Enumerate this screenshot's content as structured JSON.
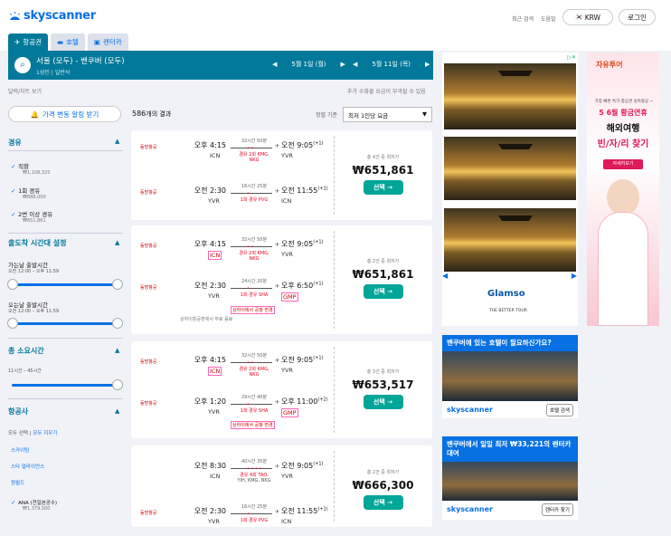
{
  "header": {
    "logo": "skyscanner",
    "links": [
      "최근 검색",
      "도움말"
    ],
    "currency": "KRW",
    "login": "로그인"
  },
  "tabs": [
    {
      "label": "항공권"
    },
    {
      "label": "호텔"
    },
    {
      "label": "렌터카"
    }
  ],
  "search": {
    "route": "서울 (모두) - 밴쿠버 (모두)",
    "sub": "1성인 | 일반석",
    "depart_date": "5월 1일 (월)",
    "return_date": "5월 11일 (목)"
  },
  "sublinks": {
    "left": "달력/차트 보기",
    "right": "추가 수화물 요금이 부과될 수 있음"
  },
  "alert_btn": "가격 변동 알림 받기",
  "results": {
    "count": "586",
    "suffix": "개의 결과",
    "sort_label": "정렬 기준",
    "sort_value": "최저 1인당 요금"
  },
  "filters": {
    "stops_title": "경유",
    "stops": [
      {
        "label": "직항",
        "price": "₩1,108,325"
      },
      {
        "label": "1회 경유",
        "price": "₩888,000"
      },
      {
        "label": "2번 이상 경유",
        "price": "₩651,861"
      }
    ],
    "time_title": "출도착 시간대 설정",
    "outbound_label": "가는날 출발시간",
    "outbound_range": "오전 12:00 – 오후 11:59",
    "return_label": "오는날 출발시간",
    "return_range": "오전 12:00 – 오후 11:59",
    "duration_title": "총 소요시간",
    "duration_range": "11시간 – 45시간",
    "airlines_title": "항공사",
    "airlines_links": [
      "모두 선택",
      "모두 지우기"
    ],
    "airline_groups": [
      "스카이팀",
      "스타 얼라이언스",
      "원월드"
    ],
    "airline_item": {
      "label": "ANA (전일본공수)",
      "price": "₩1,379,500"
    }
  },
  "cards": [
    {
      "legs": [
        {
          "airline": "동방항공",
          "dep": "오후 4:15",
          "dap": "ICN",
          "dur": "32시간 50분",
          "stops": "경유 2회 KMG,",
          "stops2": "NKG",
          "arr": "오전 9:05",
          "plus": "(+1)",
          "aap": "YVR"
        },
        {
          "airline": "동방항공",
          "dep": "오전 2:30",
          "dap": "YVR",
          "dur": "16시간 25분",
          "stops": "1회 경유 PVG",
          "stops2": "",
          "arr": "오전 11:55",
          "plus": "(+1)",
          "aap": "ICN"
        }
      ],
      "deals": "총 4건 중 최저가",
      "price": "₩651,861",
      "select": "선택 →"
    },
    {
      "legs": [
        {
          "airline": "동방항공",
          "dep": "오후 4:15",
          "dap": "ICN",
          "dur": "32시간 50분",
          "stops": "경유 2회 KMG,",
          "stops2": "NKG",
          "arr": "오전 9:05",
          "plus": "(+1)",
          "aap": "YVR"
        },
        {
          "airline": "동방항공",
          "dep": "오전 2:30",
          "dap": "YVR",
          "dur": "24시간 20분",
          "stops": "1회 경유 SHA",
          "stops2": "",
          "arr": "오후 6:50",
          "plus": "(+1)",
          "aap": "GMP"
        }
      ],
      "note": "상하이항공편에서 무료 음료",
      "note2": "상하이에서 공항 변경",
      "deals": "총 2건 중 최저가",
      "price": "₩651,861",
      "select": "선택 →"
    },
    {
      "legs": [
        {
          "airline": "동방항공",
          "dep": "오후 4:15",
          "dap": "ICN",
          "dur": "32시간 50분",
          "stops": "경유 2회 KMG,",
          "stops2": "NKG",
          "arr": "오전 9:05",
          "plus": "(+1)",
          "aap": "YVR"
        },
        {
          "airline": "동방항공",
          "dep": "오후 1:20",
          "dap": "YVR",
          "dur": "29시간 40분",
          "stops": "1회 경유 SHA",
          "stops2": "",
          "arr": "오후 11:00",
          "plus": "(+2)",
          "aap": "GMP"
        }
      ],
      "note2": "상하이에서 공항 변경",
      "deals": "총 3건 중 최저가",
      "price": "₩653,517",
      "select": "선택 →"
    },
    {
      "legs": [
        {
          "airline": "",
          "dep": "오전 8:30",
          "dap": "ICN",
          "dur": "40시간 35분",
          "stops": "경유 4회 TAO,",
          "stops2": "YIH, KMG, NKG",
          "arr": "오전 9:05",
          "plus": "(+1)",
          "aap": "YVR"
        },
        {
          "airline": "동방항공",
          "dep": "오전 2:30",
          "dap": "YVR",
          "dur": "16시간 25분",
          "stops": "1회 경유 PVG",
          "stops2": "",
          "arr": "오전 11:55",
          "plus": "(+1)",
          "aap": "ICN"
        }
      ],
      "deals": "총 2건 중 최저가",
      "price": "₩666,300",
      "select": "선택 →"
    }
  ],
  "ads": {
    "banner_brand": "Glamso",
    "banner_tag": "THE BETTER TOUR",
    "side_brand": "자유투어",
    "side_l1": "가장 빠른 특가 항공권 실속항공 ~",
    "side_l2": "5 6월 황금연휴",
    "side_l3": "해외여행",
    "side_l4": "빈/자/리 찾기",
    "side_btn": "자세히보기",
    "hotel1_title": "밴쿠버에 있는 호텔이 필요하신가요?",
    "hotel1_btn": "호텔 검색",
    "hotel2_title": "밴쿠버에서 일일 최저 ₩33,221의 렌터카 대여",
    "hotel2_btn": "렌터카 찾기",
    "brand": "skyscanner"
  }
}
